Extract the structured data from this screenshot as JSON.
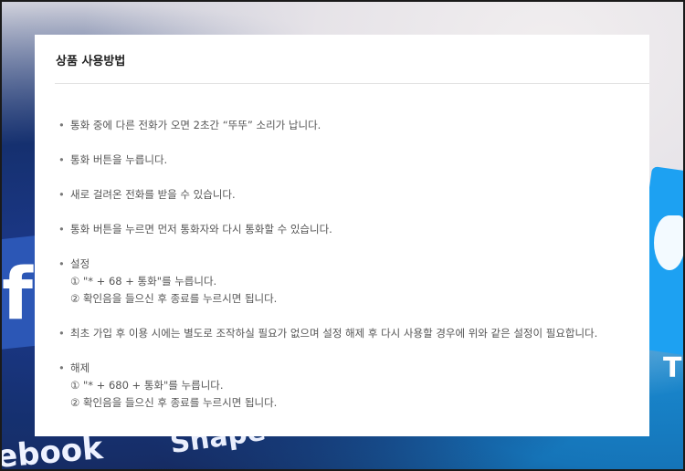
{
  "background": {
    "left_word": "ebook",
    "mid_word": "Shape",
    "left_letter": "f",
    "right_letter": "T"
  },
  "card": {
    "title": "상품 사용방법",
    "bullet_glyph": "•",
    "items": [
      {
        "text": "통화 중에 다른 전화가 오면 2초간 “뚜뚜” 소리가 납니다."
      },
      {
        "text": "통화 버튼을 누릅니다."
      },
      {
        "text": "새로 걸려온 전화를 받을 수 있습니다."
      },
      {
        "text": "통화 버튼을 누르면 먼저 통화자와 다시 통화할 수 있습니다."
      },
      {
        "text": "설정",
        "steps": [
          "① \"* + 68 + 통화\"를 누릅니다.",
          "② 확인음을 들으신 후 종료를 누르시면 됩니다."
        ]
      },
      {
        "text": "최초 가입 후 이용 시에는 별도로 조작하실 필요가 없으며 설정 해제 후 다시 사용할 경우에 위와 같은 설정이 필요합니다."
      },
      {
        "text": "해제",
        "steps": [
          "① \"* + 680 + 통화\"를 누릅니다.",
          "② 확인음을 들으신 후 종료를 누르시면 됩니다."
        ]
      }
    ]
  }
}
